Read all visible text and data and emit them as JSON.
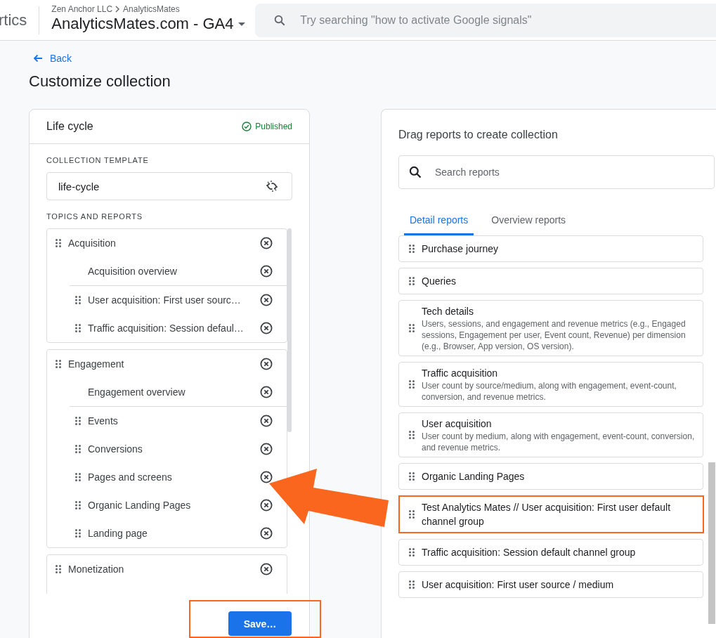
{
  "header": {
    "product_partial": "rtics",
    "breadcrumb": [
      "Zen Anchor LLC",
      "AnalyticsMates"
    ],
    "property": "AnalyticsMates.com - GA4",
    "search": {
      "placeholder": "Try searching \"how to activate Google signals\""
    }
  },
  "back_link": "Back",
  "page_title": "Customize collection",
  "collection": {
    "name": "Life cycle",
    "status": "Published",
    "template_label": "COLLECTION TEMPLATE",
    "template": "life-cycle",
    "topics_label": "TOPICS AND REPORTS",
    "topics": [
      {
        "name": "Acquisition",
        "reports": [
          {
            "name": "Acquisition overview",
            "kind": "overview"
          },
          {
            "name": "User acquisition: First user sourc…",
            "kind": "report"
          },
          {
            "name": "Traffic acquisition: Session defaul…",
            "kind": "report"
          }
        ]
      },
      {
        "name": "Engagement",
        "reports": [
          {
            "name": "Engagement overview",
            "kind": "overview"
          },
          {
            "name": "Events",
            "kind": "report"
          },
          {
            "name": "Conversions",
            "kind": "report"
          },
          {
            "name": "Pages and screens",
            "kind": "report"
          },
          {
            "name": "Organic Landing Pages",
            "kind": "report"
          },
          {
            "name": "Landing page",
            "kind": "report"
          }
        ]
      },
      {
        "name": "Monetization"
      }
    ],
    "save_button": {
      "label": "Save…",
      "highlighted": true
    }
  },
  "library": {
    "title": "Drag reports to create collection",
    "search": {
      "placeholder": "Search reports"
    },
    "tabs": [
      {
        "label": "Detail reports",
        "selected": true
      },
      {
        "label": "Overview reports",
        "selected": false
      }
    ],
    "reports": [
      {
        "name": "Purchase journey",
        "highlighted": false
      },
      {
        "name": "Queries",
        "highlighted": false
      },
      {
        "name": "Tech details",
        "description": "Users, sessions, and engagement and revenue metrics (e.g., Engaged sessions, Engagement per user, Event count, Revenue) per dimension (e.g., Browser, App version, OS version).",
        "highlighted": false
      },
      {
        "name": "Traffic acquisition",
        "description": "User count by source/medium, along with engagement, event-count, conversion, and revenue metrics.",
        "highlighted": false
      },
      {
        "name": "User acquisition",
        "description": "User count by medium, along with engagement, event-count, conversion, and revenue metrics.",
        "highlighted": false
      },
      {
        "name": "Organic Landing Pages",
        "highlighted": false
      },
      {
        "name": "Test Analytics Mates // User acquisition: First user default channel group",
        "highlighted": true
      },
      {
        "name": "Traffic acquisition: Session default channel group",
        "highlighted": false
      },
      {
        "name": "User acquisition: First user source / medium",
        "highlighted": false
      }
    ]
  }
}
